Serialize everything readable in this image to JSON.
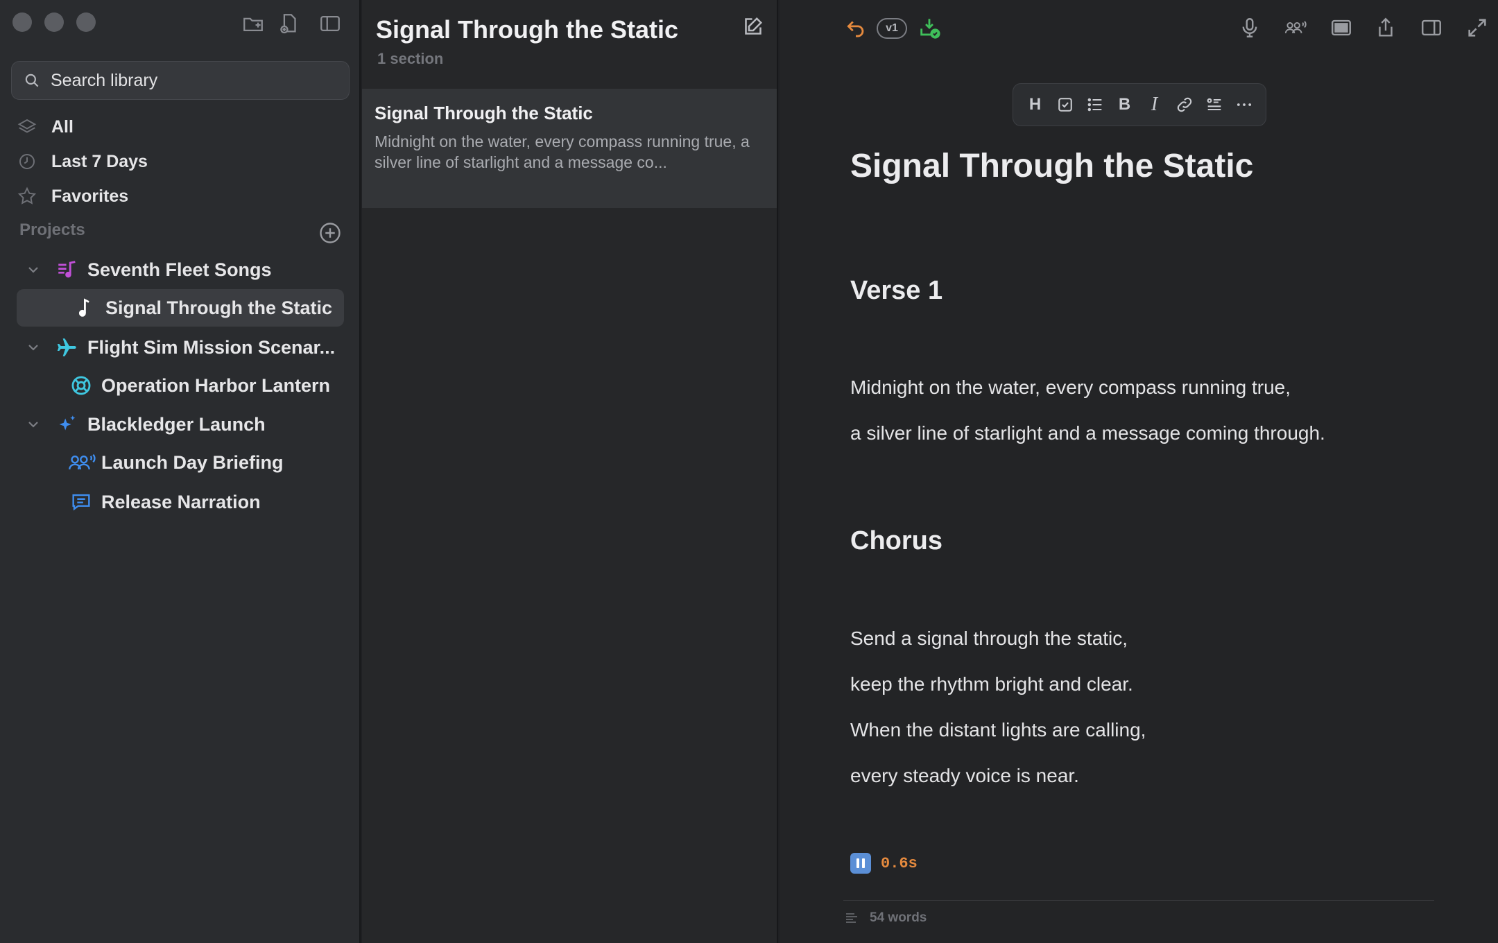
{
  "sidebar": {
    "search_placeholder": "Search library",
    "nav": [
      {
        "label": "All"
      },
      {
        "label": "Last 7 Days"
      },
      {
        "label": "Favorites"
      }
    ],
    "projects_label": "Projects",
    "tree": [
      {
        "label": "Seventh Fleet Songs",
        "icon": "music-list-icon",
        "color": "#c150d8"
      },
      {
        "label": "Signal Through the Static",
        "icon": "music-note-icon",
        "color": "#ffffff",
        "selected": true
      },
      {
        "label": "Flight Sim Mission Scenar...",
        "icon": "airplane-icon",
        "color": "#3fc7e0"
      },
      {
        "label": "Operation Harbor Lantern",
        "icon": "lifebuoy-icon",
        "color": "#3fc7e0"
      },
      {
        "label": "Blackledger Launch",
        "icon": "sparkles-icon",
        "color": "#3f8ef0"
      },
      {
        "label": "Launch Day Briefing",
        "icon": "group-speaking-icon",
        "color": "#3f8ef0"
      },
      {
        "label": "Release Narration",
        "icon": "chat-bubble-icon",
        "color": "#3f8ef0"
      }
    ]
  },
  "list": {
    "title": "Signal Through the Static",
    "subtitle": "1 section",
    "note": {
      "title": "Signal Through the Static",
      "snippet": "Midnight on the water, every compass running true, a silver line of starlight and a message co..."
    }
  },
  "editor": {
    "version_badge": "v1",
    "format_bar": {
      "heading": "H",
      "bold": "B",
      "italic": "I"
    },
    "doc": {
      "title": "Signal Through the Static",
      "sections": [
        {
          "heading": "Verse 1",
          "lines": [
            "Midnight on the water, every compass running true,",
            "a silver line of starlight and a message coming through."
          ]
        },
        {
          "heading": "Chorus",
          "lines": [
            "Send a signal through the static,",
            "keep the rhythm bright and clear.",
            "When the distant lights are calling,",
            "every steady voice is near."
          ]
        }
      ]
    },
    "timer": "0.6s",
    "word_count": "54 words"
  },
  "colors": {
    "accent_orange": "#e58a3e",
    "accent_green": "#3fbf5a",
    "accent_blue": "#5b8fd6"
  }
}
